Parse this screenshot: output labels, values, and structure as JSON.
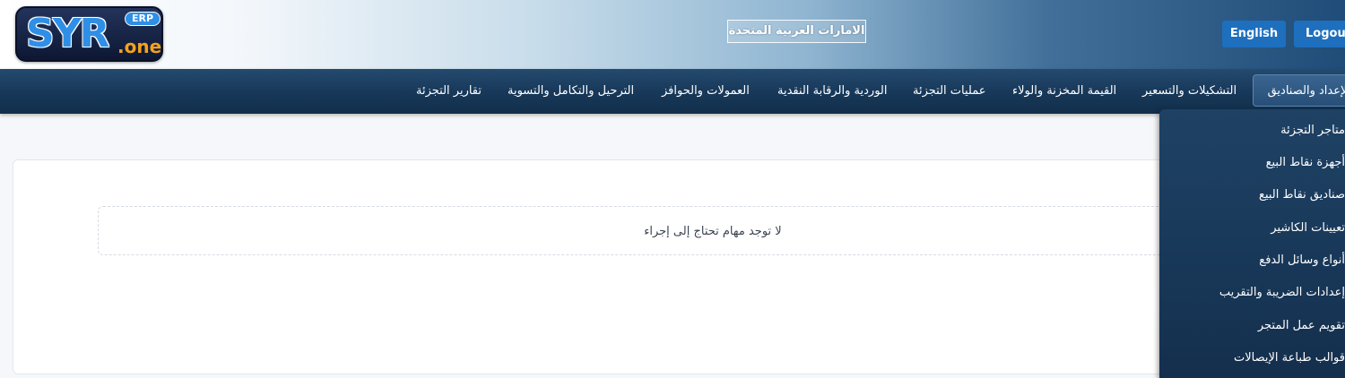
{
  "header": {
    "logo": {
      "text": "SYR",
      "badge": "ERP",
      "suffix": ".one"
    },
    "region": "الامارات العربية المتحدة",
    "buttons": {
      "english": "English",
      "logout": "Logout"
    }
  },
  "nav": {
    "items": [
      {
        "label": "الإعداد والصناديق",
        "active": true
      },
      {
        "label": "التشكيلات والتسعير"
      },
      {
        "label": "القيمة المخزنة والولاء"
      },
      {
        "label": "عمليات التجزئة"
      },
      {
        "label": "الوردية والرقابة النقدية"
      },
      {
        "label": "العمولات والحوافز"
      },
      {
        "label": "الترحيل والتكامل والتسوية"
      },
      {
        "label": "تقارير التجزئة"
      }
    ]
  },
  "dropdown": {
    "items": [
      "متاجر التجزئة",
      "أجهزة نقاط البيع",
      "صناديق نقاط البيع",
      "تعيينات الكاشير",
      "أنواع وسائل الدفع",
      "إعدادات الضريبة والتقريب",
      "تقويم عمل المتجر",
      "قوالب طباعة الإيصالات"
    ]
  },
  "main": {
    "empty_message": "لا توجد مهام تحتاج إلى إجراء"
  },
  "colors": {
    "navbar": "#18395a",
    "button": "#1e6fbe",
    "logo_blue": "#2f8fe6",
    "logo_orange": "#f4a21d"
  }
}
